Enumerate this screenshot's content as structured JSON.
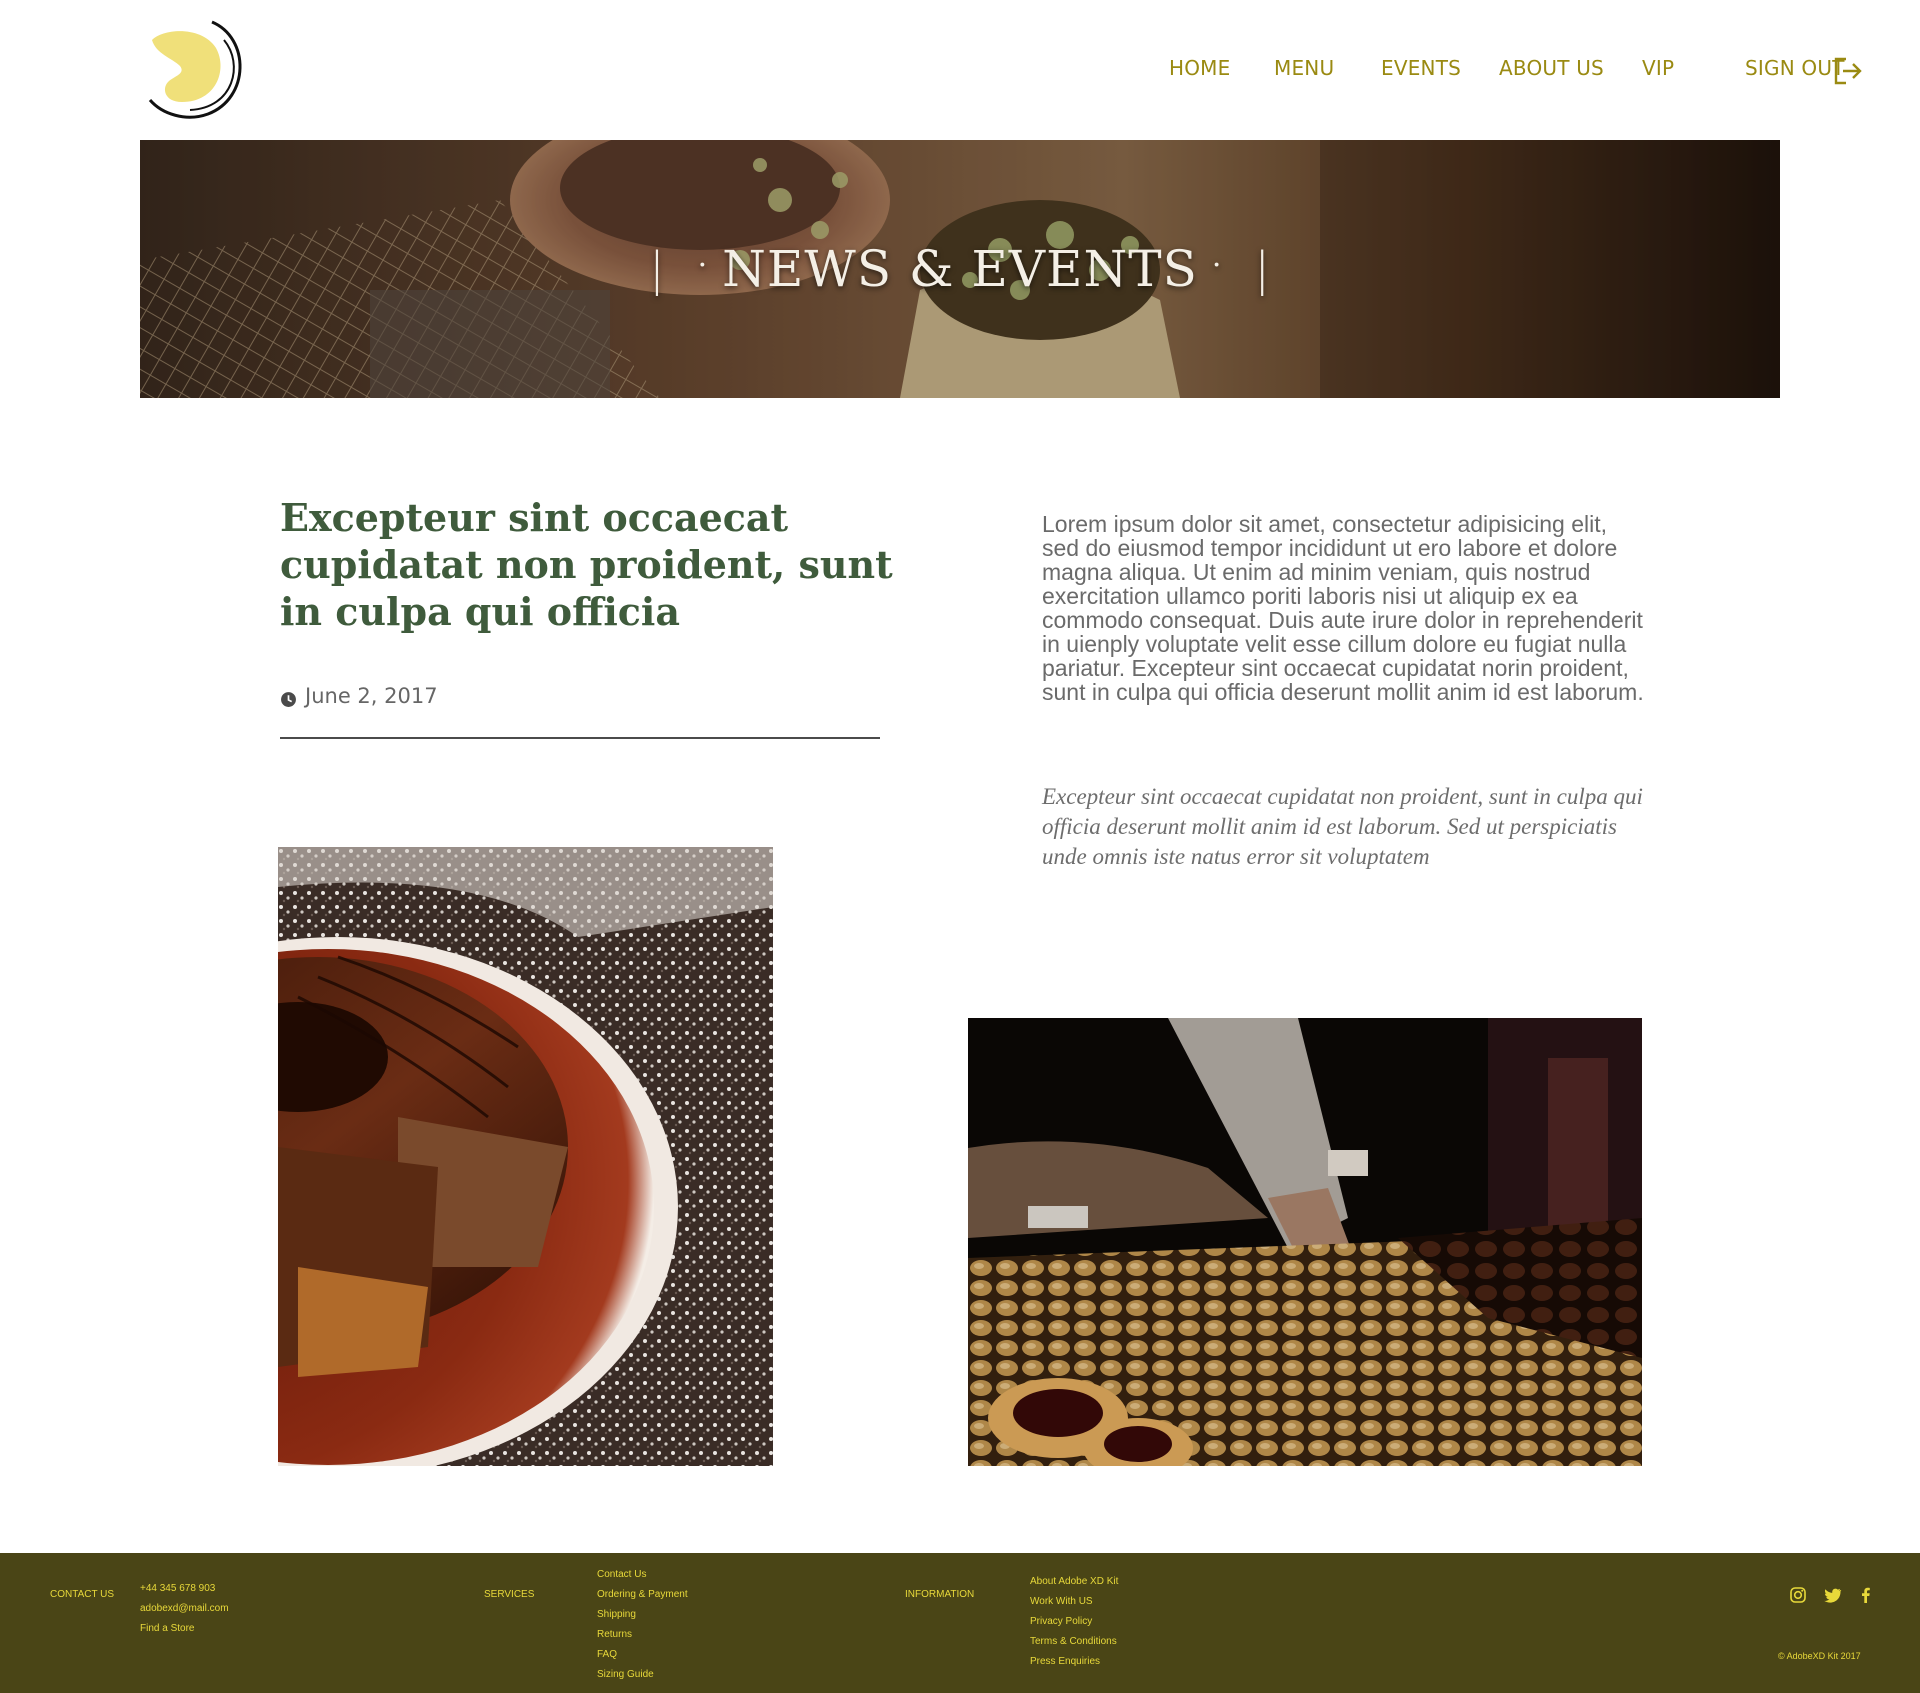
{
  "nav": {
    "home": "HOME",
    "menu": "MENU",
    "events": "EVENTS",
    "about": "ABOUT US",
    "vip": "VIP",
    "signout": "SIGN OUT"
  },
  "hero": {
    "title": "NEWS & EVENTS"
  },
  "article": {
    "headline": "Excepteur sint occaecat cupidatat non proident, sunt in culpa qui officia",
    "date": "June 2, 2017",
    "body": "Lorem ipsum dolor sit amet, consectetur adipisicing elit, sed do eiusmod tempor incididunt ut ero labore et dolore magna aliqua. Ut enim ad minim veniam, quis nostrud exercitation ullamco poriti laboris nisi ut aliquip ex ea commodo consequat. Duis aute irure dolor in reprehenderit in uienply voluptate velit esse cillum dolore eu fugiat nulla pariatur. Excepteur sint occaecat cupidatat norin proident, sunt in culpa qui officia deserunt mollit anim id est laborum.",
    "quote": "Excepteur sint occaecat cupidatat non proident, sunt in culpa qui officia deserunt mollit anim id est laborum. Sed ut perspiciatis unde omnis iste natus error sit voluptatem"
  },
  "footer": {
    "contact": {
      "heading": "CONTACT US",
      "phone": "+44 345 678 903",
      "email": "adobexd@mail.com",
      "store": "Find a Store"
    },
    "services": {
      "heading": "SERVICES",
      "links": [
        "Contact Us",
        "Ordering & Payment",
        "Shipping",
        "Returns",
        "FAQ",
        "Sizing Guide"
      ]
    },
    "information": {
      "heading": "INFORMATION",
      "links": [
        "About Adobe XD Kit",
        "Work With US",
        "Privacy Policy",
        "Terms & Conditions",
        "Press Enquiries"
      ]
    },
    "copyright": "© AdobeXD Kit 2017"
  },
  "icons": {
    "logo": "crescent-moon-logo",
    "signout": "sign-out-icon",
    "date": "clock-icon",
    "social": [
      "instagram-icon",
      "twitter-icon",
      "facebook-icon"
    ]
  },
  "colors": {
    "nav": "#9a8a12",
    "headline": "#3f5b3c",
    "footer_bg": "#4a4516",
    "footer_text": "#e8d93a",
    "logo_fill": "#f0e07a"
  }
}
